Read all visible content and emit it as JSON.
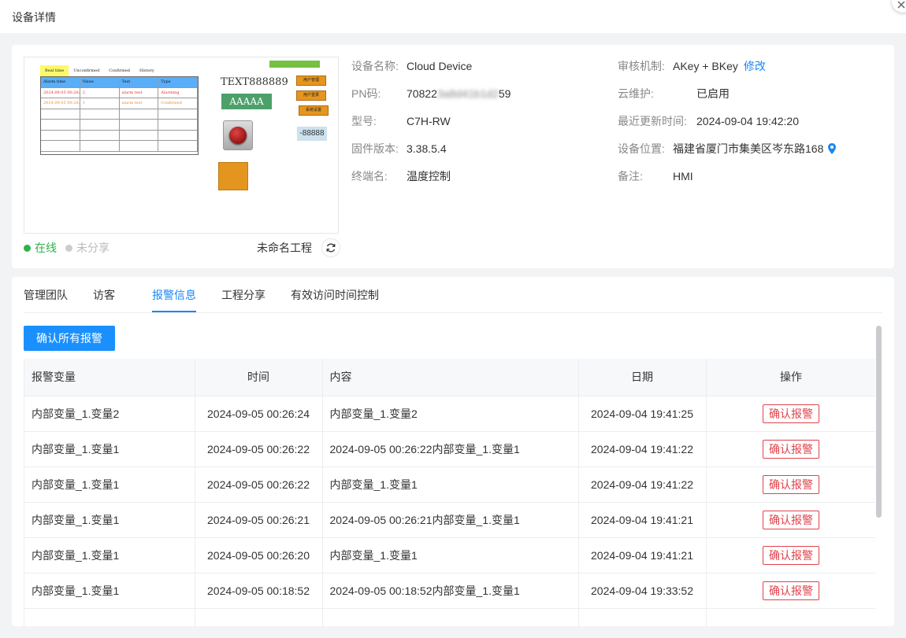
{
  "modal": {
    "title": "设备详情"
  },
  "preview": {
    "tabs": [
      "Real time",
      "Unconfirmed",
      "Confirmed",
      "History"
    ],
    "table_headers": [
      "Alarm time",
      "Value",
      "Text",
      "Type"
    ],
    "table_rows": [
      [
        "2024.09.05 00:26:24",
        "2",
        "alarm text",
        "Alarming"
      ],
      [
        "2024.09.05 00:26:24",
        "1",
        "alarm text",
        "Confirmed"
      ]
    ],
    "text_label": "TEXT888889",
    "button_text": "AAAAA",
    "side_buttons": [
      "用户管理",
      "用户登录",
      "系统设置"
    ],
    "number_display": "-88888"
  },
  "status": {
    "online": "在线",
    "shared": "未分享"
  },
  "project": {
    "name": "未命名工程"
  },
  "info": {
    "left": [
      {
        "label": "设备名称:",
        "value": "Cloud Device"
      },
      {
        "label": "PN码:",
        "value": "70822",
        "blurred": "3a8d41b1d2",
        "value_end": "59"
      },
      {
        "label": "型号:",
        "value": "C7H-RW"
      },
      {
        "label": "固件版本:",
        "value": "3.38.5.4"
      },
      {
        "label": "终端名:",
        "value": "温度控制"
      }
    ],
    "right": [
      {
        "label": "审核机制:",
        "value": "AKey + BKey",
        "link": "修改"
      },
      {
        "label": "云维护:",
        "value": "已启用"
      },
      {
        "label": "最近更新时间:",
        "value": "2024-09-04 19:42:20"
      },
      {
        "label": "设备位置:",
        "value": "福建省厦门市集美区岑东路168"
      },
      {
        "label": "备注:",
        "value": "HMI"
      }
    ]
  },
  "tabs": [
    "管理团队",
    "访客",
    "报警信息",
    "工程分享",
    "有效访问时间控制"
  ],
  "active_tab": "报警信息",
  "actions": {
    "confirm_all": "确认所有报警"
  },
  "table": {
    "headers": [
      "报警变量",
      "时间",
      "内容",
      "日期",
      "操作"
    ],
    "rows": [
      {
        "variable": "内部变量_1.变量2",
        "time": "2024-09-05 00:26:24",
        "content": "内部变量_1.变量2",
        "date": "2024-09-04 19:41:25",
        "action": "确认报警"
      },
      {
        "variable": "内部变量_1.变量1",
        "time": "2024-09-05 00:26:22",
        "content": "2024-09-05 00:26:22内部变量_1.变量1",
        "date": "2024-09-04 19:41:22",
        "action": "确认报警"
      },
      {
        "variable": "内部变量_1.变量1",
        "time": "2024-09-05 00:26:22",
        "content": "内部变量_1.变量1",
        "date": "2024-09-04 19:41:22",
        "action": "确认报警"
      },
      {
        "variable": "内部变量_1.变量1",
        "time": "2024-09-05 00:26:21",
        "content": "2024-09-05 00:26:21内部变量_1.变量1",
        "date": "2024-09-04 19:41:21",
        "action": "确认报警"
      },
      {
        "variable": "内部变量_1.变量1",
        "time": "2024-09-05 00:26:20",
        "content": "内部变量_1.变量1",
        "date": "2024-09-04 19:41:21",
        "action": "确认报警"
      },
      {
        "variable": "内部变量_1.变量1",
        "time": "2024-09-05 00:18:52",
        "content": "2024-09-05 00:18:52内部变量_1.变量1",
        "date": "2024-09-04 19:33:52",
        "action": "确认报警"
      },
      {
        "variable": "",
        "time": "",
        "content": "",
        "date": "",
        "action": ""
      }
    ]
  },
  "colors": {
    "primary": "#1a90ff",
    "online": "#2cb34a",
    "danger": "#e0434b"
  }
}
